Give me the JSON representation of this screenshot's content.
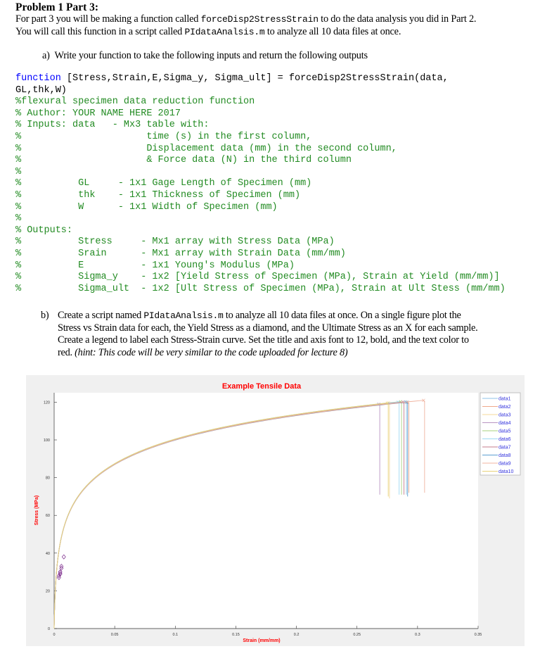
{
  "heading": "Problem 1 Part 3:",
  "intro": {
    "line1_a": "For part 3 you will be making a function called ",
    "line1_code": "forceDisp2StressStrain",
    "line1_b": " to do the data analysis you did in Part 2.",
    "line2_a": "You will call this function in a script called ",
    "line2_code": "PIdataAnalsis.m",
    "line2_b": " to  analyze all 10 data files at once."
  },
  "part_a": {
    "label": "a)",
    "text": "Write your function to take the following inputs and return the following outputs"
  },
  "code": {
    "keyword": "function",
    "sig1": " [Stress,Strain,E,Sigma_y, Sigma_ult] = forceDisp2StressStrain(data,",
    "sig2": "GL,thk,W)",
    "comments": [
      "%flexural specimen data reduction function",
      "% Author: YOUR NAME HERE 2017",
      "% Inputs: data   - Mx3 table with:",
      "%                      time (s) in the first column,",
      "%                      Displacement data (mm) in the second column,",
      "%                      & Force data (N) in the third column",
      "%",
      "%          GL     - 1x1 Gage Length of Specimen (mm)",
      "%          thk    - 1x1 Thickness of Specimen (mm)",
      "%          W      - 1x1 Width of Specimen (mm)",
      "%",
      "% Outputs:",
      "%          Stress     - Mx1 array with Stress Data (MPa)",
      "%          Srain      - Mx1 array with Strain Data (mm/mm)",
      "%          E          - 1x1 Young's Modulus (MPa)",
      "%          Sigma_y    - 1x2 [Yield Stress of Specimen (MPa), Strain at Yield (mm/mm)]",
      "%          Sigma_ult  - 1x2 [Ult Stress of Specimen (MPa), Strain at Ult Stess (mm/mm)"
    ]
  },
  "part_b": {
    "label": "b)",
    "line1_a": "Create a script named  ",
    "line1_code": "PIdataAnalsis.m",
    "line1_b": " to  analyze all 10 data files at once.  On a single figure plot the",
    "line2": "Stress vs Strain data for each, the Yield Stress as a diamond, and the Ultimate Stress as an X for each sample.",
    "line3": "Create a legend to label each Stress-Strain curve. Set the title and axis font to 12, bold, and the text color to",
    "line4_a": "red.  ",
    "line4_hint": "(hint: This code will be very similar to the code uploaded for lecture 8)"
  },
  "chart_data": {
    "type": "line",
    "title": "Example Tensile Data",
    "xlabel": "Strain (mm/mm)",
    "ylabel": "Stress (MPa)",
    "xlim": [
      0,
      0.35
    ],
    "ylim": [
      0,
      125
    ],
    "xticks": [
      "0",
      "0.05",
      "0.1",
      "0.15",
      "0.2",
      "0.25",
      "0.3",
      "0.35"
    ],
    "yticks": [
      "0",
      "20",
      "40",
      "60",
      "80",
      "100",
      "120"
    ],
    "title_color": "#ff0000",
    "legend_position": "outside-top-right",
    "grid": false,
    "series": [
      {
        "name": "data1",
        "color": "#8fc3e8",
        "yield": [
          0.005,
          30
        ],
        "ultimate": [
          0.29,
          120.2
        ],
        "fracture_stress": 71
      },
      {
        "name": "data2",
        "color": "#efa98c",
        "yield": [
          0.005,
          29
        ],
        "ultimate": [
          0.292,
          120.0
        ],
        "fracture_stress": 72
      },
      {
        "name": "data3",
        "color": "#f4d89a",
        "yield": [
          0.004,
          28
        ],
        "ultimate": [
          0.276,
          119.7
        ],
        "fracture_stress": 69
      },
      {
        "name": "data4",
        "color": "#b994c3",
        "yield": [
          0.004,
          27
        ],
        "ultimate": [
          0.268,
          119.0
        ],
        "fracture_stress": 71
      },
      {
        "name": "data5",
        "color": "#a9d07e",
        "yield": [
          0.006,
          33
        ],
        "ultimate": [
          0.286,
          120.3
        ],
        "fracture_stress": 71
      },
      {
        "name": "data6",
        "color": "#9edaf2",
        "yield": [
          0.006,
          32
        ],
        "ultimate": [
          0.284,
          120.1
        ],
        "fracture_stress": 71
      },
      {
        "name": "data7",
        "color": "#c57c8c",
        "yield": [
          0.005,
          29
        ],
        "ultimate": [
          0.288,
          120.1
        ],
        "fracture_stress": 71
      },
      {
        "name": "data8",
        "color": "#5c9fd1",
        "yield": [
          0.005,
          30
        ],
        "ultimate": [
          0.291,
          120.0
        ],
        "fracture_stress": 70
      },
      {
        "name": "data9",
        "color": "#f0b4a0",
        "yield": [
          0.008,
          38
        ],
        "ultimate": [
          0.305,
          121.0
        ],
        "fracture_stress": 72
      },
      {
        "name": "data10",
        "color": "#e8d27a",
        "yield": [
          0.005,
          29
        ],
        "ultimate": [
          0.275,
          119.5
        ],
        "fracture_stress": 70
      }
    ]
  }
}
